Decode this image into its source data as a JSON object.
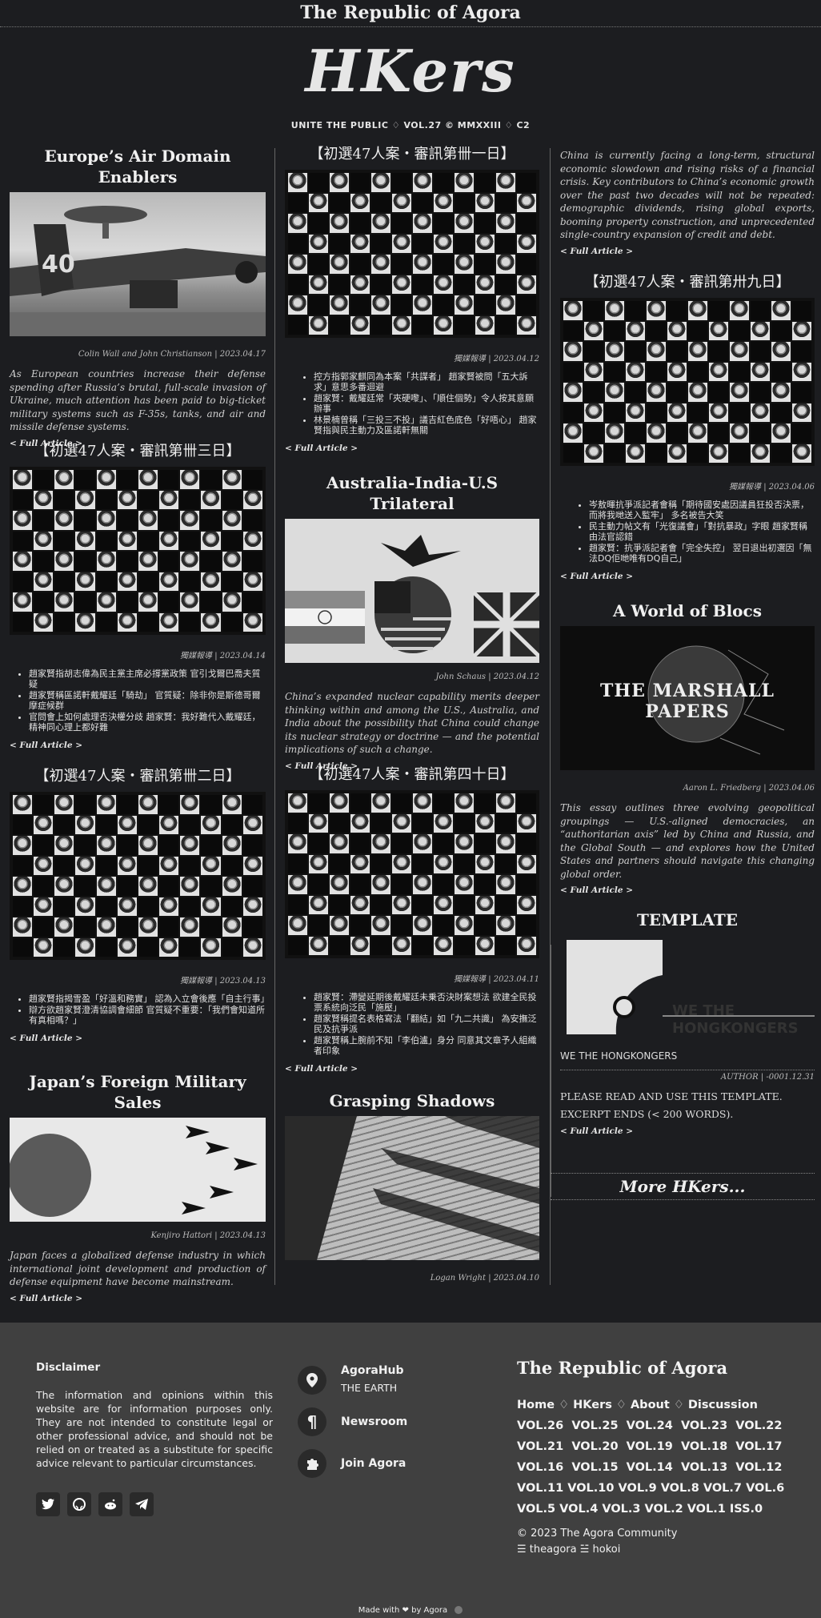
{
  "site_title": "The Republic of Agora",
  "masthead": "HKers",
  "tagline": "UNITE THE PUBLIC ♢ VOL.27 © MMXXIII ♢ C2",
  "col1": {
    "a1": {
      "headline": "Europe’s Air Domain Enablers",
      "byline": "Colin Wall and John Christianson | 2023.04.17",
      "summary": "As European countries increase their defense spending after Russia’s brutal, full-scale invasion of Ukraine, much attention has been paid to big-ticket military systems such as F-35s, tanks, and air and missile defense systems.",
      "link": "< Full Article >"
    },
    "a2": {
      "headline": "【初選47人案・審訊第卌三日】",
      "byline": "獨媒報導 | 2023.04.14",
      "bullets": [
        "趙家賢指胡志偉為民主黨主席必撐黨政策 官引戈爾巴喬夫質疑",
        "趙家賢稱區諾軒戴耀廷「騎劫」 官質疑：除非你是斯德哥爾摩症候群",
        "官問會上如何處理否決權分歧 趙家賢：我好難代入戴耀廷，精神同心理上都好難"
      ],
      "link": "< Full Article >"
    },
    "a3": {
      "headline": "【初選47人案・審訊第卌二日】",
      "byline": "獨媒報導 | 2023.04.13",
      "bullets": [
        "趙家賢指揭雪盈「好溫和務實」 認為入立會後應「自主行事」",
        "辯方欲趙家賢澄清協調會細節 官質疑不重要：「我們會知道所有真相嗎？」"
      ],
      "link": "< Full Article >"
    },
    "a4": {
      "headline": "Japan’s Foreign Military Sales",
      "byline": "Kenjiro Hattori | 2023.04.13",
      "summary": "Japan faces a globalized defense industry in which international joint development and production of defense equipment have become mainstream.",
      "link": "< Full Article >"
    }
  },
  "col2": {
    "a1": {
      "headline": "【初選47人案・審訊第卌一日】",
      "byline": "獨媒報導 | 2023.04.12",
      "bullets": [
        "控方指郭家麒同為本案「共謀者」 趙家賢被問「五大訴求」意思多番迴避",
        "趙家賢：戴耀廷常「夾硬嚟」、「順住個勢」令人按其意願辦事",
        "林景楠曾稱「三投三不投」議吉紅色底色「好唔心」 趙家賢指與民主動力及區諾軒無關"
      ],
      "link": "< Full Article >"
    },
    "a2": {
      "headline": "Australia-India-U.S Trilateral",
      "byline": "John Schaus | 2023.04.12",
      "summary": "China’s expanded nuclear capability merits deeper thinking within and among the U.S., Australia, and India about the possibility that China could change its nuclear strategy or doctrine — and the potential implications of such a change.",
      "link": "< Full Article >"
    },
    "a3": {
      "headline": "【初選47人案・審訊第四十日】",
      "byline": "獨媒報導 | 2023.04.11",
      "bullets": [
        "趙家賢：滯變延期後戴耀廷未乗否決財案想法 欲建全民投票系統向泛民「施壓」",
        "趙家賢稱提名表格寫法「翻結」如「九二共識」 為安撫泛民及抗爭派",
        "趙家賢稱上腕前不知「李伯瀘」身分 同意其文章予人組織者印象"
      ],
      "link": "< Full Article >"
    },
    "a4": {
      "headline": "Grasping Shadows",
      "byline": "Logan Wright | 2023.04.10"
    }
  },
  "col3": {
    "a1": {
      "summary": "China is currently facing a long-term, structural economic slowdown and rising risks of a financial crisis. Key contributors to China’s economic growth over the past two decades will not be repeated: demographic dividends, rising global exports, booming property construction, and unprecedented single-country expansion of credit and debt.",
      "link": "< Full Article >"
    },
    "a2": {
      "headline": "【初選47人案・審訊第卅九日】",
      "byline": "獨媒報導 | 2023.04.06",
      "bullets": [
        "岑敖暉抗爭派記者會稱「期待國安處因議員狂投否決票，而將我哋送入監牢」 多名被告大笑",
        "民主動力帖文有「光復議會」「對抗暴政」字眼 趙家賢稱由法官認錯",
        "趙家賢：抗爭派記者會「完全失控」 翌日退出初選因「無法DQ佢哋唯有DQ自己」"
      ],
      "link": "< Full Article >"
    },
    "a3": {
      "headline": "A World of Blocs",
      "image_text": "THE MARSHALL PAPERS",
      "byline": "Aaron L. Friedberg | 2023.04.06",
      "summary": "This essay outlines three evolving geopolitical groupings — U.S.-aligned democracies, an “authoritarian axis” led by China and Russia, and the Global South — and explores how the United States and partners should navigate this changing global order.",
      "link": "< Full Article >"
    },
    "a4": {
      "headline": "TEMPLATE",
      "logo_text": "WE THE HONGKONGERS",
      "caption": "WE THE HONGKONGERS",
      "byline": "AUTHOR | -0001.12.31",
      "body1": "PLEASE READ AND USE THIS TEMPLATE.",
      "body2": "EXCERPT ENDS (< 200 WORDS).",
      "link": "< Full Article >"
    },
    "more": "More HKers..."
  },
  "footer": {
    "disclaimer_title": "Disclaimer",
    "disclaimer_text": "The information and opinions within this website are for information purposes only. They are not intended to constitute legal or other professional advice, and should not be relied on or treated as a substitute for specific advice relevant to particular circumstances.",
    "hub_title": "AgoraHub",
    "hub_sub": "THE EARTH",
    "newsroom": "Newsroom",
    "join": "Join Agora",
    "brand": "The Republic of Agora",
    "nav": "Home ♢ HKers ♢ About ♢ Discussion",
    "vols1": "VOL.26  VOL.25  VOL.24  VOL.23  VOL.22",
    "vols2": "VOL.21  VOL.20  VOL.19  VOL.18  VOL.17",
    "vols3": "VOL.16  VOL.15  VOL.14  VOL.13  VOL.12",
    "vols4": "VOL.11 VOL.10 VOL.9 VOL.8 VOL.7 VOL.6",
    "vols5": "VOL.5 VOL.4 VOL.3 VOL.2 VOL.1 ISS.0",
    "copyright": "© 2023 The Agora Community",
    "handles": "☰ theagora ☱ hokoi",
    "madewith": "Made with ❤ by Agora"
  }
}
